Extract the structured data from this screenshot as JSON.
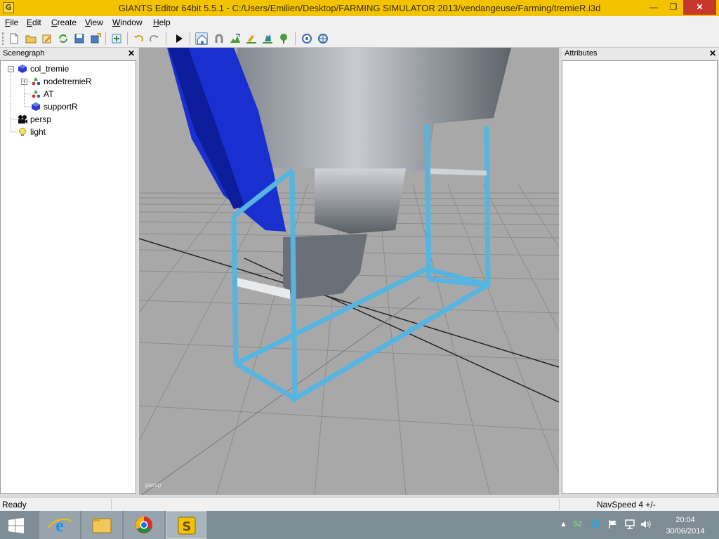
{
  "window": {
    "title": "GIANTS Editor 64bit 5.5.1 - C:/Users/Emilien/Desktop/FARMING SIMULATOR 2013/vendangeuse/Farming/tremieR.i3d",
    "app_icon_letter": "G",
    "minimize": "—",
    "maximize": "❐",
    "close": "✕"
  },
  "menu": [
    {
      "label": "File",
      "accel": "F",
      "rest": "ile"
    },
    {
      "label": "Edit",
      "accel": "E",
      "rest": "dit"
    },
    {
      "label": "Create",
      "accel": "C",
      "rest": "reate"
    },
    {
      "label": "View",
      "accel": "V",
      "rest": "iew"
    },
    {
      "label": "Window",
      "accel": "W",
      "rest": "indow"
    },
    {
      "label": "Help",
      "accel": "H",
      "rest": "elp"
    }
  ],
  "toolbar": {
    "buttons": [
      "new-file-icon",
      "open-folder-icon",
      "edit-icon",
      "refresh-icon",
      "save-icon",
      "export-icon",
      "undo-icon",
      "redo-icon",
      "play-icon",
      "home-icon",
      "magnet-icon",
      "terrain-icon",
      "paint-icon",
      "foliage-icon",
      "tree-icon",
      "navigate-icon",
      "settings-icon"
    ],
    "active": "home-icon"
  },
  "scenegraph": {
    "title": "Scenegraph",
    "close": "✕",
    "nodes": [
      {
        "label": "col_tremie",
        "icon": "cube-icon"
      },
      {
        "label": "nodetremieR",
        "icon": "transform-group-icon"
      },
      {
        "label": "AT",
        "icon": "transform-group-icon"
      },
      {
        "label": "supportR",
        "icon": "cube-icon"
      },
      {
        "label": "persp",
        "icon": "camera-icon"
      },
      {
        "label": "light",
        "icon": "light-bulb-icon"
      }
    ]
  },
  "attributes": {
    "title": "Attributes",
    "close": "✕"
  },
  "viewport": {
    "camera_label": "persp",
    "background": "#a8a8a8",
    "frame_color": "#55b4e0",
    "blue_part": "#1a2fd0"
  },
  "status": {
    "left": "Ready",
    "nav_speed": "NavSpeed 4 +/-"
  },
  "taskbar": {
    "apps": [
      "internet-explorer-icon",
      "file-explorer-icon",
      "chrome-icon",
      "giants-editor-icon"
    ],
    "tray_number": "52",
    "time": "20:04",
    "date": "30/06/2014"
  }
}
